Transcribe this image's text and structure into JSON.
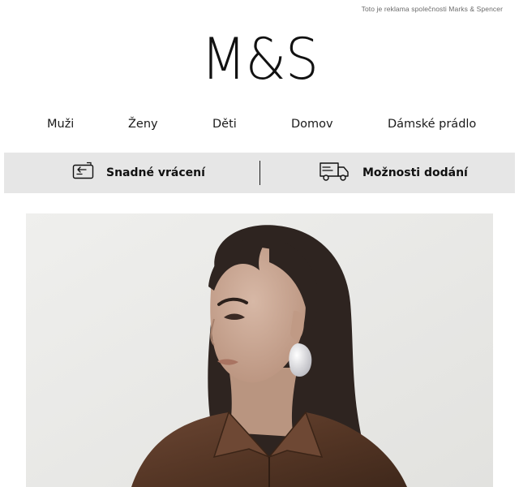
{
  "header": {
    "disclaimer": "Toto je reklama společnosti Marks & Spencer",
    "logo": "M&S"
  },
  "nav": {
    "items": [
      {
        "label": "Muži"
      },
      {
        "label": "Ženy"
      },
      {
        "label": "Děti"
      },
      {
        "label": "Domov"
      },
      {
        "label": "Dámské prádlo"
      }
    ]
  },
  "benefits": {
    "returns": {
      "label": "Snadné vrácení",
      "icon": "return-card-icon"
    },
    "delivery": {
      "label": "Možnosti dodání",
      "icon": "delivery-truck-icon"
    }
  },
  "hero": {
    "image": "woman-brown-leather-jacket-photo",
    "colors": {
      "background": "#ebebe9",
      "hair": "#2e2420",
      "skin": "#c9a996",
      "jacket": "#5b3b2a",
      "earring": "#e9e9ec"
    }
  }
}
